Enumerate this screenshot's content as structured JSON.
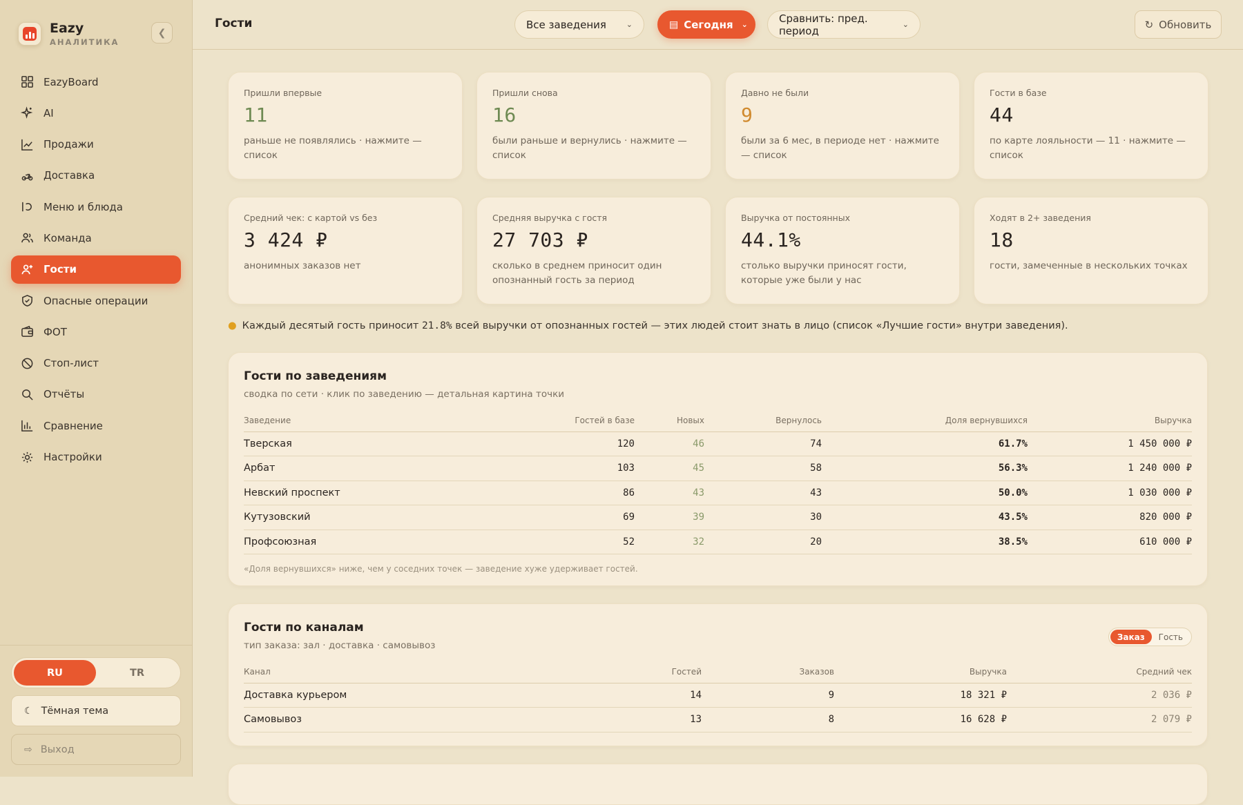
{
  "brand": {
    "name": "Eazy",
    "subtitle": "АНАЛИТИКА"
  },
  "sidebar": {
    "items": [
      {
        "label": "EazyBoard",
        "icon": "grid-icon"
      },
      {
        "label": "AI",
        "icon": "sparkle-icon"
      },
      {
        "label": "Продажи",
        "icon": "trend-icon"
      },
      {
        "label": "Доставка",
        "icon": "scooter-icon"
      },
      {
        "label": "Меню и блюда",
        "icon": "dish-icon"
      },
      {
        "label": "Команда",
        "icon": "team-icon"
      },
      {
        "label": "Гости",
        "icon": "guest-icon",
        "active": true
      },
      {
        "label": "Опасные операции",
        "icon": "shield-icon"
      },
      {
        "label": "ФОТ",
        "icon": "wallet-icon"
      },
      {
        "label": "Стоп-лист",
        "icon": "stop-icon"
      },
      {
        "label": "Отчёты",
        "icon": "search-icon"
      },
      {
        "label": "Сравнение",
        "icon": "bar-chart-icon"
      },
      {
        "label": "Настройки",
        "icon": "gear-icon"
      }
    ],
    "lang": {
      "ru": "RU",
      "tr": "TR"
    },
    "theme_label": "Тёмная тема",
    "logout_label": "Выход"
  },
  "header": {
    "title": "Гости",
    "venue_select": "Все заведения",
    "date_select": "Сегодня",
    "compare_select": "Сравнить: пред. период",
    "refresh_label": "Обновить"
  },
  "kpis_row1": [
    {
      "label": "Пришли впервые",
      "value": "11",
      "desc": "раньше не появлялись · нажмите — список"
    },
    {
      "label": "Пришли снова",
      "value": "16",
      "desc": "были раньше и вернулись · нажмите — список"
    },
    {
      "label": "Давно не были",
      "value": "9",
      "desc": "были за 6 мес, в периоде нет · нажмите — список"
    },
    {
      "label": "Гости в базе",
      "value": "44",
      "desc": "по карте лояльности — 11 · нажмите — список"
    }
  ],
  "kpis_row2": [
    {
      "label": "Средний чек: с картой vs без",
      "value": "3 424 ₽",
      "desc": "анонимных заказов нет"
    },
    {
      "label": "Средняя выручка с гостя",
      "value": "27 703 ₽",
      "desc": "сколько в среднем приносит один опознанный гость за период"
    },
    {
      "label": "Выручка от постоянных",
      "value": "44.1%",
      "desc": "столько выручки приносят гости, которые уже были у нас"
    },
    {
      "label": "Ходят в 2+ заведения",
      "value": "18",
      "desc": "гости, замеченные в нескольких точках"
    }
  ],
  "tip": {
    "before": "Каждый десятый гость приносит ",
    "value": "21.8%",
    "after": " всей выручки от опознанных гостей — этих людей стоит знать в лицо (список «Лучшие гости» внутри заведения)."
  },
  "venues": {
    "title": "Гости по заведениям",
    "subtitle": "сводка по сети · клик по заведению — детальная картина точки",
    "columns": [
      "Заведение",
      "Гостей в базе",
      "Новых",
      "Вернулось",
      "Доля вернувшихся",
      "Выручка"
    ],
    "rows": [
      [
        "Тверская",
        "120",
        "46",
        "74",
        "61.7%",
        "1 450 000 ₽"
      ],
      [
        "Арбат",
        "103",
        "45",
        "58",
        "56.3%",
        "1 240 000 ₽"
      ],
      [
        "Невский проспект",
        "86",
        "43",
        "43",
        "50.0%",
        "1 030 000 ₽"
      ],
      [
        "Кутузовский",
        "69",
        "39",
        "30",
        "43.5%",
        "820 000 ₽"
      ],
      [
        "Профсоюзная",
        "52",
        "32",
        "20",
        "38.5%",
        "610 000 ₽"
      ]
    ],
    "note": "«Доля вернувшихся» ниже, чем у соседних точек — заведение хуже удерживает гостей."
  },
  "channels": {
    "title": "Гости по каналам",
    "subtitle": "тип заказа: зал · доставка · самовывоз",
    "toggle": [
      "Заказ",
      "Гость"
    ],
    "columns": [
      "Канал",
      "Гостей",
      "Заказов",
      "Выручка",
      "Средний чек"
    ],
    "rows": [
      [
        "Доставка курьером",
        "14",
        "9",
        "18 321 ₽",
        "2 036 ₽"
      ],
      [
        "Самовывоз",
        "13",
        "8",
        "16 628 ₽",
        "2 079 ₽"
      ]
    ]
  },
  "colors": {
    "accent": "#e8582f",
    "positive": "#6e8a52",
    "warning": "#d08a2e"
  }
}
